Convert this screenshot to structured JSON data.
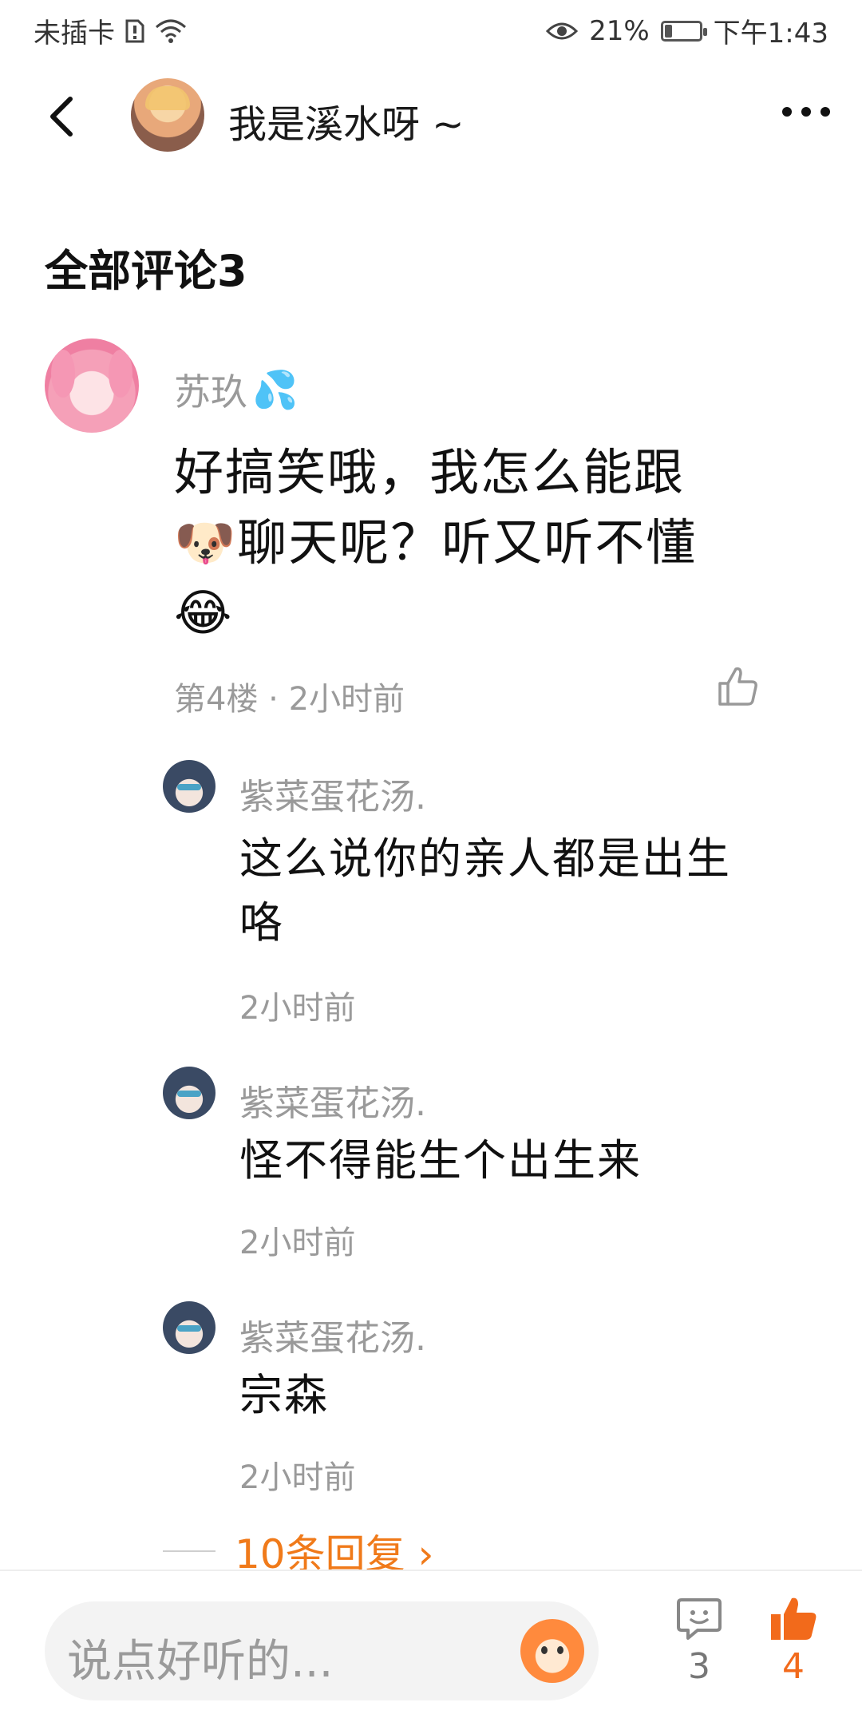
{
  "status_bar": {
    "carrier": "未插卡",
    "battery": "21%",
    "battery_level": 0.21,
    "time": "下午1:43"
  },
  "header": {
    "title": "我是溪水呀 ~"
  },
  "section": {
    "title": "全部评论3"
  },
  "comment": {
    "author": "苏玖",
    "author_emoji": "💦",
    "text_line1": "好搞笑哦，我怎么能跟",
    "text_line2_emoji": "🐶",
    "text_line2": "聊天呢？听又听不懂",
    "text_line3_emoji": "😂",
    "meta": "第4楼 · 2小时前"
  },
  "replies": [
    {
      "author": "紫菜蛋花汤.",
      "text_line1": "这么说你的亲人都是出生",
      "text_line2": "咯",
      "time": "2小时前"
    },
    {
      "author": "紫菜蛋花汤.",
      "text_line1": "怪不得能生个出生来",
      "time": "2小时前"
    },
    {
      "author": "紫菜蛋花汤.",
      "text_line1": "宗森",
      "time": "2小时前"
    }
  ],
  "more_replies": {
    "label": "10条回复 ›"
  },
  "bottom_bar": {
    "input_placeholder": "说点好听的...",
    "comment_count": "3",
    "like_count": "4",
    "accent_color": "#f26a1b"
  }
}
